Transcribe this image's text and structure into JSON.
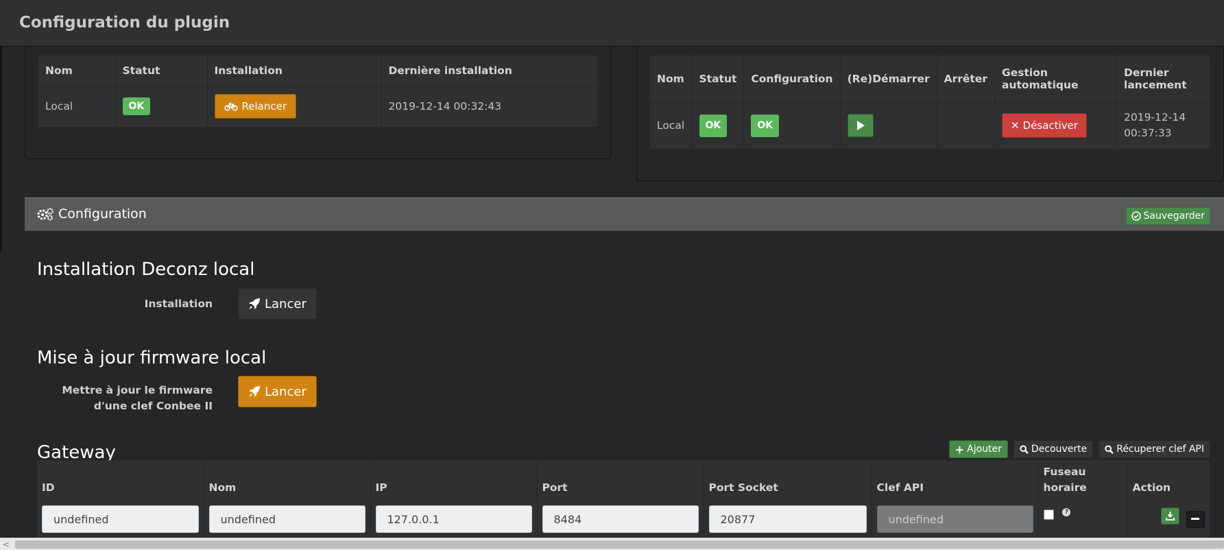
{
  "modal": {
    "title": "Configuration du plugin"
  },
  "dependencies": {
    "headers": [
      "Nom",
      "Statut",
      "Installation",
      "Dernière installation"
    ],
    "row": {
      "name": "Local",
      "status": "OK",
      "action": "Relancer",
      "last_install": "2019-12-14 00:32:43"
    }
  },
  "daemon": {
    "headers": [
      "Nom",
      "Statut",
      "Configuration",
      "(Re)Démarrer",
      "Arrêter",
      "Gestion automatique",
      "Dernier lancement"
    ],
    "row": {
      "name": "Local",
      "status": "OK",
      "configuration": "OK",
      "stop": "",
      "auto_label": "Désactiver",
      "last_launch": "2019-12-14 00:37:33"
    }
  },
  "configuration": {
    "title": "Configuration",
    "save_label": "Sauvegarder",
    "install_section": {
      "title": "Installation Deconz local",
      "label": "Installation",
      "button": "Lancer"
    },
    "firmware_section": {
      "title": "Mise à jour firmware local",
      "label": "Mettre à jour le firmware d'une clef Conbee II",
      "button": "Lancer"
    },
    "gateway": {
      "title": "Gateway",
      "buttons": {
        "add": "Ajouter",
        "discover": "Decouverte",
        "get_key": "Récuperer clef API"
      },
      "headers": [
        "ID",
        "Nom",
        "IP",
        "Port",
        "Port Socket",
        "Clef API",
        "Fuseau horaire",
        "Action"
      ],
      "row": {
        "id": "undefined",
        "name": "undefined",
        "ip": "127.0.0.1",
        "port": "8484",
        "port_socket": "20877",
        "api_key": "undefined"
      }
    }
  },
  "colors": {
    "success": "#5cb85c",
    "warning": "#d08412",
    "danger": "#c9403c",
    "background": "#252627"
  }
}
